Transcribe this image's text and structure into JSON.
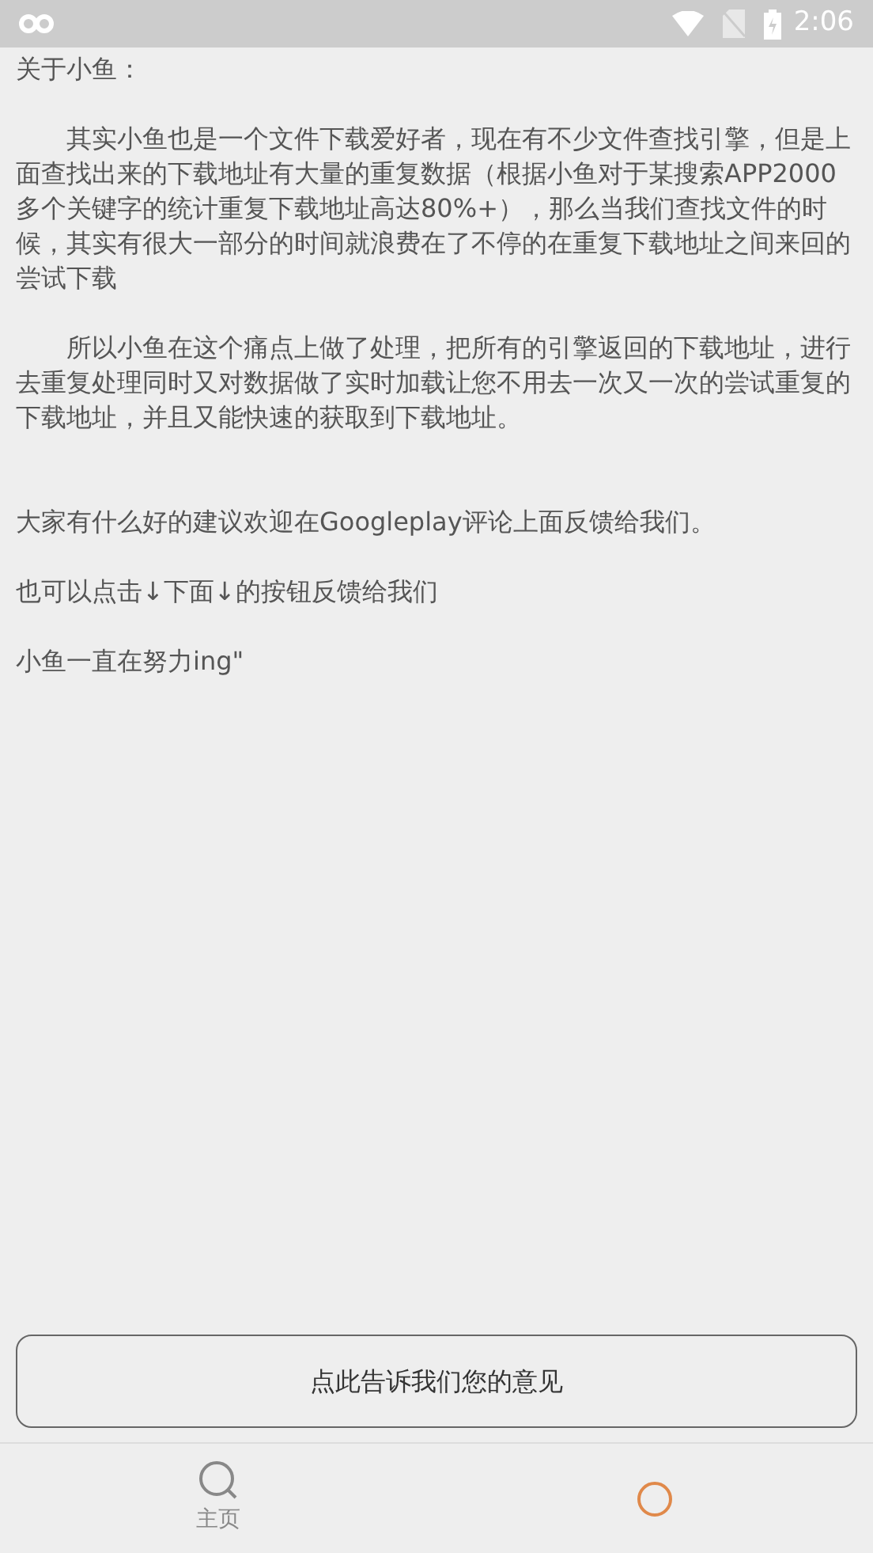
{
  "status_bar": {
    "time": "2:06"
  },
  "title": "关于小鱼：",
  "paragraphs": [
    {
      "kind": "indented",
      "text": "其实小鱼也是一个文件下载爱好者，现在有不少文件查找引擎，但是上面查找出来的下载地址有大量的重复数据（根据小鱼对于某搜索APP2000多个关键字的统计重复下载地址高达80%+），那么当我们查找文件的时候，其实有很大一部分的时间就浪费在了不停的在重复下载地址之间来回的尝试下载"
    },
    {
      "kind": "indented",
      "text": "所以小鱼在这个痛点上做了处理，把所有的引擎返回的下载地址，进行去重复处理同时又对数据做了实时加载让您不用去一次又一次的尝试重复的下载地址，并且又能快速的获取到下载地址。"
    },
    {
      "kind": "plain",
      "text": "大家有什么好的建议欢迎在Googleplay评论上面反馈给我们。"
    },
    {
      "kind": "plain",
      "text": "也可以点击↓下面↓的按钮反馈给我们"
    },
    {
      "kind": "plain",
      "text": "小鱼一直在努力ing\""
    }
  ],
  "feedback_button": "点此告诉我们您的意见",
  "tabs": [
    {
      "label": "主页",
      "selected": false
    },
    {
      "selected": true
    }
  ]
}
